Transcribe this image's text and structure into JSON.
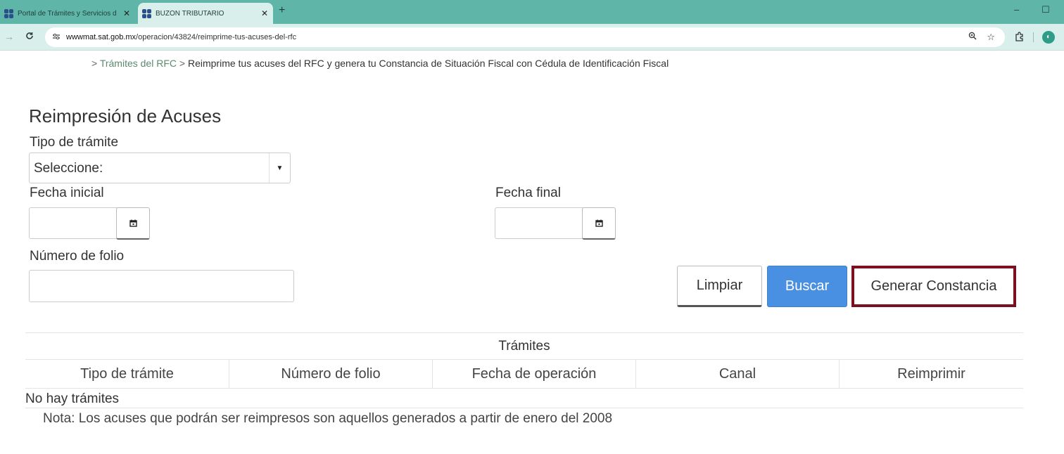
{
  "browser": {
    "tabs": [
      {
        "title": "Portal de Trámites y Servicios d",
        "active": false
      },
      {
        "title": "BUZÓN TRIBUTARIO",
        "active": true
      }
    ],
    "url_host": "wwwmat.sat.gob.mx",
    "url_path": "/operacion/43824/reimprime-tus-acuses-del-rfc",
    "icons": {
      "back": "←",
      "reload": "C",
      "site_info": "⚙",
      "zoom": "⊕",
      "bookmark": "☆",
      "extensions": "⧉",
      "new_tab": "+",
      "close": "✕",
      "minimize": "–",
      "maximize": "☐"
    },
    "accent_color": "#5fb6a8"
  },
  "breadcrumb": {
    "prefix": ">",
    "link": "Trámites del RFC",
    "sep": ">",
    "current": "Reimprime tus acuses del RFC y genera tu Constancia de Situación Fiscal con Cédula de Identificación Fiscal"
  },
  "page": {
    "title": "Reimpresión de Acuses"
  },
  "form": {
    "tipo_label": "Tipo de trámite",
    "tipo_value": "Seleccione:",
    "fecha_inicial_label": "Fecha inicial",
    "fecha_final_label": "Fecha final",
    "folio_label": "Número de folio"
  },
  "buttons": {
    "limpiar": "Limpiar",
    "buscar": "Buscar",
    "generar": "Generar Constancia"
  },
  "table": {
    "caption": "Trámites",
    "columns": [
      "Tipo de trámite",
      "Número de folio",
      "Fecha de operación",
      "Canal",
      "Reimprimir"
    ],
    "empty_text": "No hay trámites"
  },
  "note": "Nota: Los acuses que podrán ser reimpresos son aquellos generados a partir de enero del 2008",
  "colors": {
    "primary_button": "#4a90e2",
    "highlight_border": "#7b1020",
    "breadcrumb_link": "#5b8a6e"
  }
}
